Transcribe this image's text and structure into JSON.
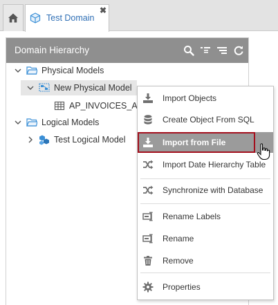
{
  "tabs": {
    "home_icon": "home-icon",
    "domain_tab_label": "Test Domain",
    "close_symbol": "✖"
  },
  "panel": {
    "title": "Domain Hierarchy",
    "header_icons": [
      "search-icon",
      "collapse-all-icon",
      "filter-list-icon",
      "refresh-icon"
    ]
  },
  "tree": {
    "physical_models": "Physical Models",
    "new_physical_model": "New Physical Model",
    "ap_invoices": "AP_INVOICES_AL",
    "logical_models": "Logical Models",
    "test_logical_model": "Test Logical Model"
  },
  "context_menu": {
    "items": [
      {
        "label": "Import Objects",
        "icon": "import-icon"
      },
      {
        "label": "Create Object From SQL",
        "icon": "database-icon"
      },
      {
        "label": "Import from File",
        "icon": "import-icon",
        "highlighted": true
      },
      {
        "label": "Import Date Hierarchy Table",
        "icon": "shuffle-icon"
      },
      {
        "label": "Synchronize with Database",
        "icon": "shuffle-icon"
      },
      {
        "label": "Rename Labels",
        "icon": "rename-icon"
      },
      {
        "label": "Rename",
        "icon": "rename-icon"
      },
      {
        "label": "Remove",
        "icon": "trash-icon"
      },
      {
        "label": "Properties",
        "icon": "gear-icon"
      }
    ]
  },
  "colors": {
    "panel_header": "#8f8f8f",
    "tab_text": "#2f6fb5",
    "highlight_bg": "#9b9b9b",
    "highlight_border": "#a30f1d",
    "folder_blue": "#3a8fd6"
  }
}
